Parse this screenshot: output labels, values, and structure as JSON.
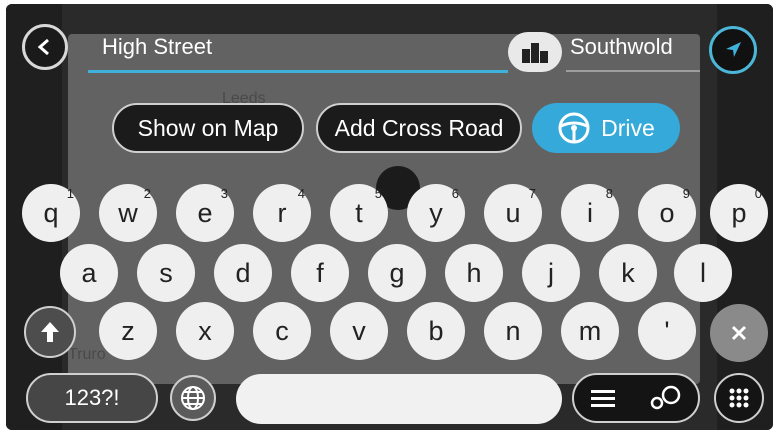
{
  "search": {
    "query": "High Street",
    "city": "Southwold"
  },
  "actions": {
    "show_on_map": "Show on Map",
    "add_cross_road": "Add Cross Road",
    "drive": "Drive"
  },
  "map_labels": [
    "Leeds",
    "Truro"
  ],
  "keyboard": {
    "row1": [
      {
        "label": "q",
        "sup": "1"
      },
      {
        "label": "w",
        "sup": "2"
      },
      {
        "label": "e",
        "sup": "3"
      },
      {
        "label": "r",
        "sup": "4"
      },
      {
        "label": "t",
        "sup": "5"
      },
      {
        "label": "y",
        "sup": "6"
      },
      {
        "label": "u",
        "sup": "7"
      },
      {
        "label": "i",
        "sup": "8"
      },
      {
        "label": "o",
        "sup": "9"
      },
      {
        "label": "p",
        "sup": "0"
      }
    ],
    "row2": [
      "a",
      "s",
      "d",
      "f",
      "g",
      "h",
      "j",
      "k",
      "l"
    ],
    "row3": [
      "z",
      "x",
      "c",
      "v",
      "b",
      "n",
      "m",
      "'"
    ],
    "numbers_label": "123?!"
  },
  "icons": {
    "back": "back-arrow-icon",
    "nav": "navigation-arrow-icon",
    "city": "city-icon",
    "drive": "steering-wheel-icon",
    "shift": "shift-arrow-icon",
    "backspace": "backspace-icon",
    "globe": "globe-icon",
    "list": "list-icon",
    "search_options": "search-options-icon",
    "menu": "menu-grid-icon"
  },
  "colors": {
    "accent": "#35a9d9",
    "background": "#2a2a2a",
    "key": "#efefef"
  }
}
